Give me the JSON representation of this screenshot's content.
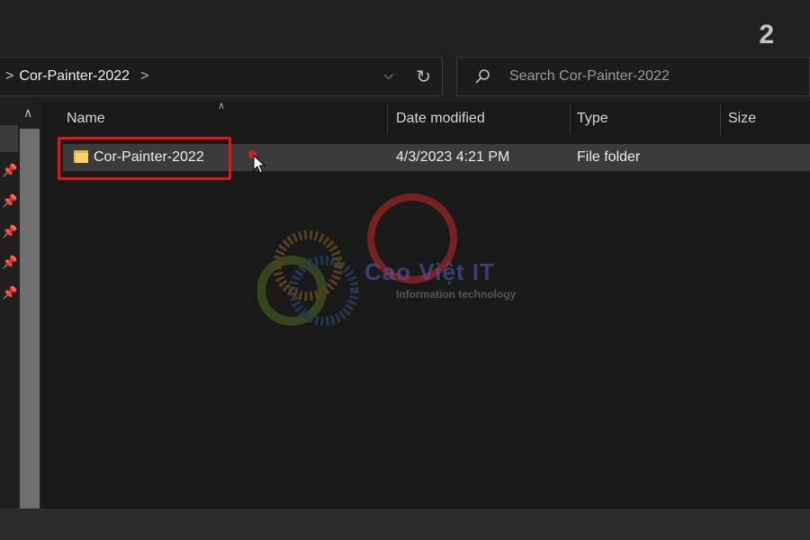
{
  "step_number": "2",
  "address_bar": {
    "separator": ">",
    "current": "Cor-Painter-2022",
    "trailing_separator": ">"
  },
  "search": {
    "placeholder": "Search Cor-Painter-2022"
  },
  "columns": [
    {
      "label": "Name"
    },
    {
      "label": "Date modified"
    },
    {
      "label": "Type"
    },
    {
      "label": "Size"
    }
  ],
  "rows": [
    {
      "name": "Cor-Painter-2022",
      "date_modified": "4/3/2023 4:21 PM",
      "type": "File folder",
      "size": ""
    }
  ],
  "watermark": {
    "title": "Cao Việt IT",
    "subtitle": "Information technology"
  },
  "colors": {
    "highlight": "#e3141b",
    "folder": "#f7d46a",
    "selected_row": "#3b3b3b"
  },
  "icons": [
    "chevron-right-icon",
    "chevron-down-icon",
    "refresh-icon",
    "search-icon",
    "pin-icon",
    "folder-icon",
    "cursor-icon"
  ]
}
